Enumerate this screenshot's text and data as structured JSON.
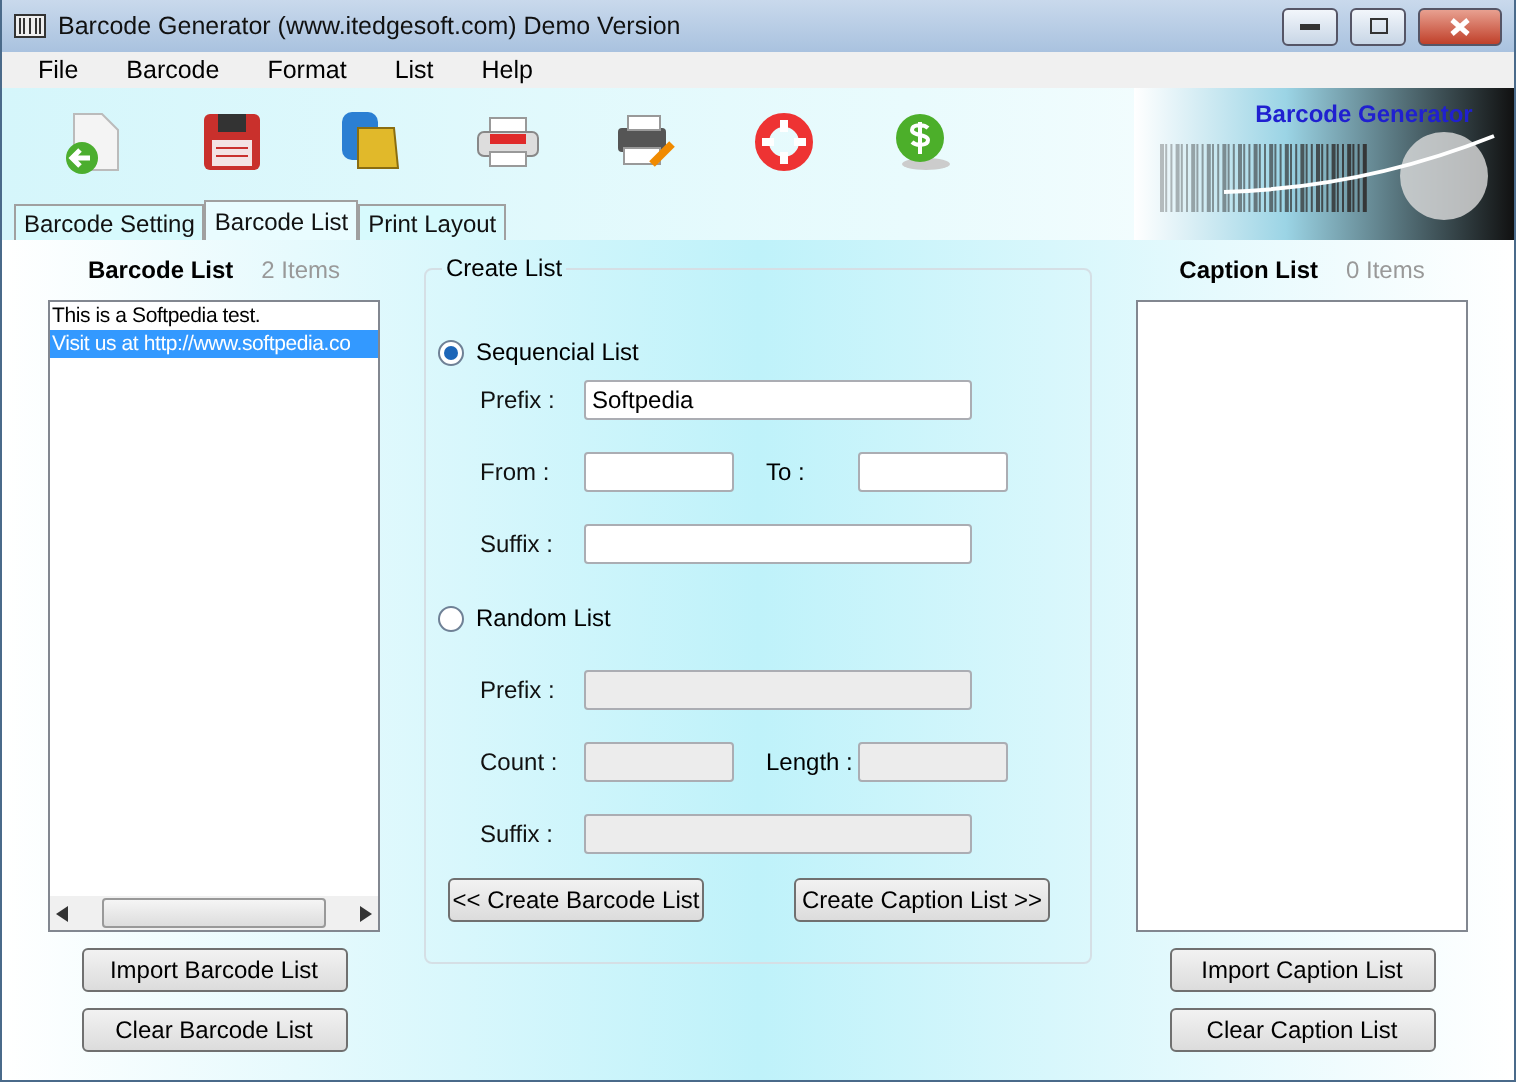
{
  "window": {
    "title": "Barcode Generator (www.itedgesoft.com) Demo Version"
  },
  "menu": [
    "File",
    "Barcode",
    "Format",
    "List",
    "Help"
  ],
  "toolbar": [
    {
      "kind": "open"
    },
    {
      "kind": "save"
    },
    {
      "kind": "copy"
    },
    {
      "kind": "print"
    },
    {
      "kind": "printer-setup"
    },
    {
      "kind": "help"
    },
    {
      "kind": "buy"
    }
  ],
  "banner": {
    "title": "Barcode Generator"
  },
  "tabs": [
    {
      "label": "Barcode Setting",
      "selected": false
    },
    {
      "label": "Barcode List",
      "selected": true
    },
    {
      "label": "Print Layout",
      "selected": false
    }
  ],
  "barcode_list": {
    "title": "Barcode List",
    "count": "2 Items",
    "items": [
      {
        "text": "This is a Softpedia test.",
        "selected": false
      },
      {
        "text": "Visit us at http://www.softpedia.co",
        "selected": true
      }
    ],
    "buttons": [
      "Import Barcode List",
      "Clear Barcode List"
    ]
  },
  "create_list": {
    "title": "Create List",
    "options": [
      {
        "label": "Sequencial List",
        "selected": true,
        "rows": [
          [
            {
              "label": "Prefix :",
              "value": "Softpedia",
              "wide": true
            }
          ],
          [
            {
              "label": "From :",
              "wide": false
            },
            {
              "label": "To :",
              "wide": false
            }
          ],
          [
            {
              "label": "Suffix :",
              "wide": true
            }
          ]
        ]
      },
      {
        "label": "Random List",
        "selected": false,
        "rows": [
          [
            {
              "label": "Prefix :",
              "wide": true
            }
          ],
          [
            {
              "label": "Count :",
              "wide": false
            },
            {
              "label": "Length :",
              "wide": false
            }
          ],
          [
            {
              "label": "Suffix :",
              "wide": true
            }
          ]
        ]
      }
    ],
    "buttons": [
      "<< Create Barcode List",
      "Create Caption List >>"
    ]
  },
  "caption_list": {
    "title": "Caption List",
    "count": "0 Items",
    "buttons": [
      "Import Caption List",
      "Clear Caption List"
    ]
  }
}
